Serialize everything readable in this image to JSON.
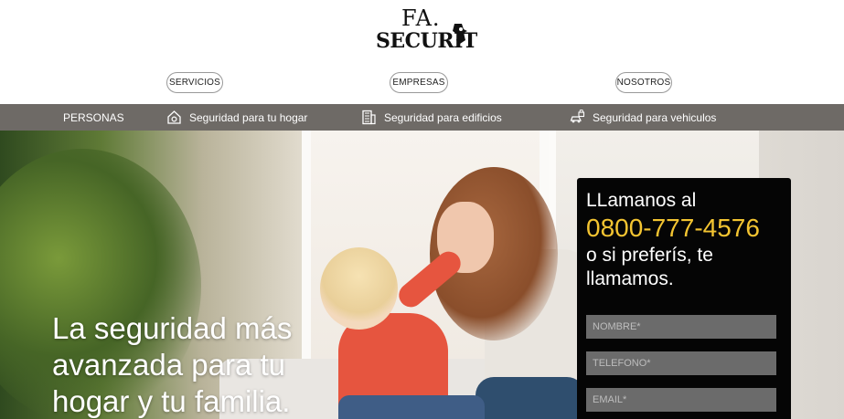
{
  "brand": {
    "logo_top": "FA.",
    "logo_bottom": "SECURIT"
  },
  "nav": {
    "servicios": "SERVICIOS",
    "empresas": "EMPRESAS",
    "nosotros": "NOSOTROS"
  },
  "subnav": {
    "personas": "PERSONAS",
    "hogar": "Seguridad para tu hogar",
    "edificios": "Seguridad para edificios",
    "vehiculos": "Seguridad para vehiculos"
  },
  "hero": {
    "headline": [
      "La seguridad más",
      "avanzada para tu",
      "hogar y tu familia."
    ]
  },
  "callbox": {
    "line1": "LLamanos al",
    "phone": "0800-777-4576",
    "line2": "o si preferís, te",
    "line3": "llamamos.",
    "name_placeholder": "NOMBRE*",
    "phone_placeholder": "TELEFONO*",
    "email_placeholder": "EMAIL*"
  },
  "colors": {
    "subnav_bg": "#6e6a66",
    "phone_accent": "#f3c431",
    "callbox_bg": "#050505",
    "input_bg": "#6b6b6b"
  }
}
